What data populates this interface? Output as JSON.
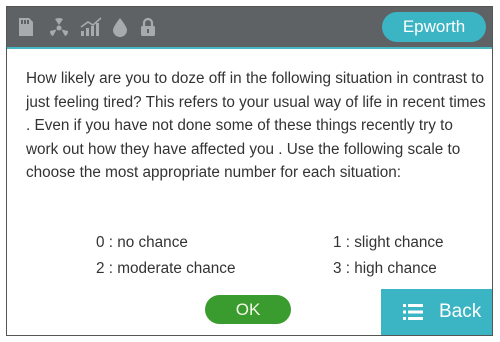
{
  "header": {
    "title": "Epworth",
    "status_icons": [
      "sd-card-icon",
      "fan-icon",
      "signal-graph-icon",
      "water-drop-icon",
      "lock-icon"
    ]
  },
  "instructions": "How likely are you to doze off in the following situation in contrast to just feeling tired? This refers to your usual way of life in recent times . Even  if  you  have  not  done some of these things  recently try  to work out how they have affected you . Use the following scale to choose the most appropriate number for each situation:",
  "scale": [
    {
      "label": "0 : no chance"
    },
    {
      "label": "1 : slight chance"
    },
    {
      "label": "2 : moderate chance"
    },
    {
      "label": "3 : high chance"
    }
  ],
  "buttons": {
    "ok": "OK",
    "back": "Back"
  },
  "colors": {
    "status_bar": "#5f6264",
    "accent_teal": "#3bb4c4",
    "ok_green": "#3a9b2f",
    "text": "#333333"
  }
}
